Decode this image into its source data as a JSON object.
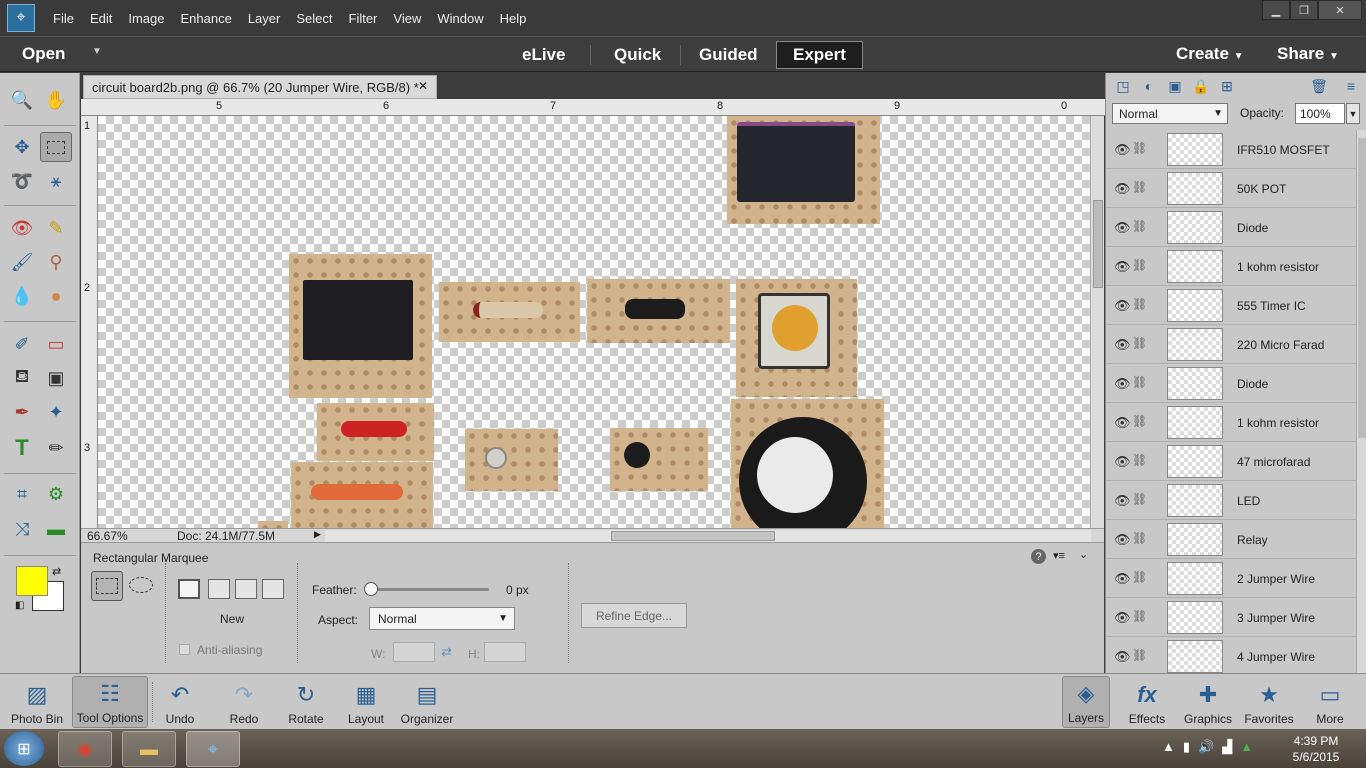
{
  "menubar": {
    "items": [
      "File",
      "Edit",
      "Image",
      "Enhance",
      "Layer",
      "Select",
      "Filter",
      "View",
      "Window",
      "Help"
    ]
  },
  "modebar": {
    "open": "Open",
    "tabs": [
      "eLive",
      "Quick",
      "Guided",
      "Expert"
    ],
    "active_tab": "Expert",
    "create": "Create",
    "share": "Share"
  },
  "document": {
    "tab_title": "circuit board2b.png @ 66.7% (20 Jumper Wire, RGB/8) *",
    "ruler_h_ticks": [
      "5",
      "6",
      "7",
      "8",
      "9",
      "0"
    ],
    "ruler_v_ticks": [
      "1",
      "2",
      "3"
    ]
  },
  "statusbar": {
    "zoom": "66.67%",
    "doc_size": "Doc: 24.1M/77.5M"
  },
  "tool_options": {
    "title": "Rectangular Marquee",
    "new_label": "New",
    "anti_aliasing_label": "Anti-aliasing",
    "feather_label": "Feather:",
    "feather_value": "0 px",
    "feather_fraction": 0,
    "aspect_label": "Aspect:",
    "aspect_value": "Normal",
    "w_label": "W:",
    "h_label": "H:",
    "refine_edge": "Refine Edge..."
  },
  "layers": {
    "blend_mode": "Normal",
    "opacity_label": "Opacity:",
    "opacity_value": "100%",
    "items": [
      {
        "name": "IFR510 MOSFET"
      },
      {
        "name": "50K POT"
      },
      {
        "name": "Diode"
      },
      {
        "name": "1 kohm resistor"
      },
      {
        "name": "555 Timer IC"
      },
      {
        "name": "220 Micro Farad"
      },
      {
        "name": "Diode"
      },
      {
        "name": "1 kohm resistor"
      },
      {
        "name": "47 microfarad"
      },
      {
        "name": "LED"
      },
      {
        "name": "Relay"
      },
      {
        "name": "2 Jumper Wire"
      },
      {
        "name": "3 Jumper Wire"
      },
      {
        "name": "4 Jumper Wire"
      }
    ]
  },
  "bottombar": {
    "left": [
      "Photo Bin",
      "Tool Options",
      "Undo",
      "Redo",
      "Rotate",
      "Layout",
      "Organizer"
    ],
    "right": [
      "Layers",
      "Effects",
      "Graphics",
      "Favorites",
      "More"
    ]
  },
  "taskbar": {
    "time": "4:39 PM",
    "date": "5/6/2015"
  },
  "colors": {
    "foreground": "#ffff00",
    "background": "#ffffff",
    "accent": "#2a5f94"
  }
}
